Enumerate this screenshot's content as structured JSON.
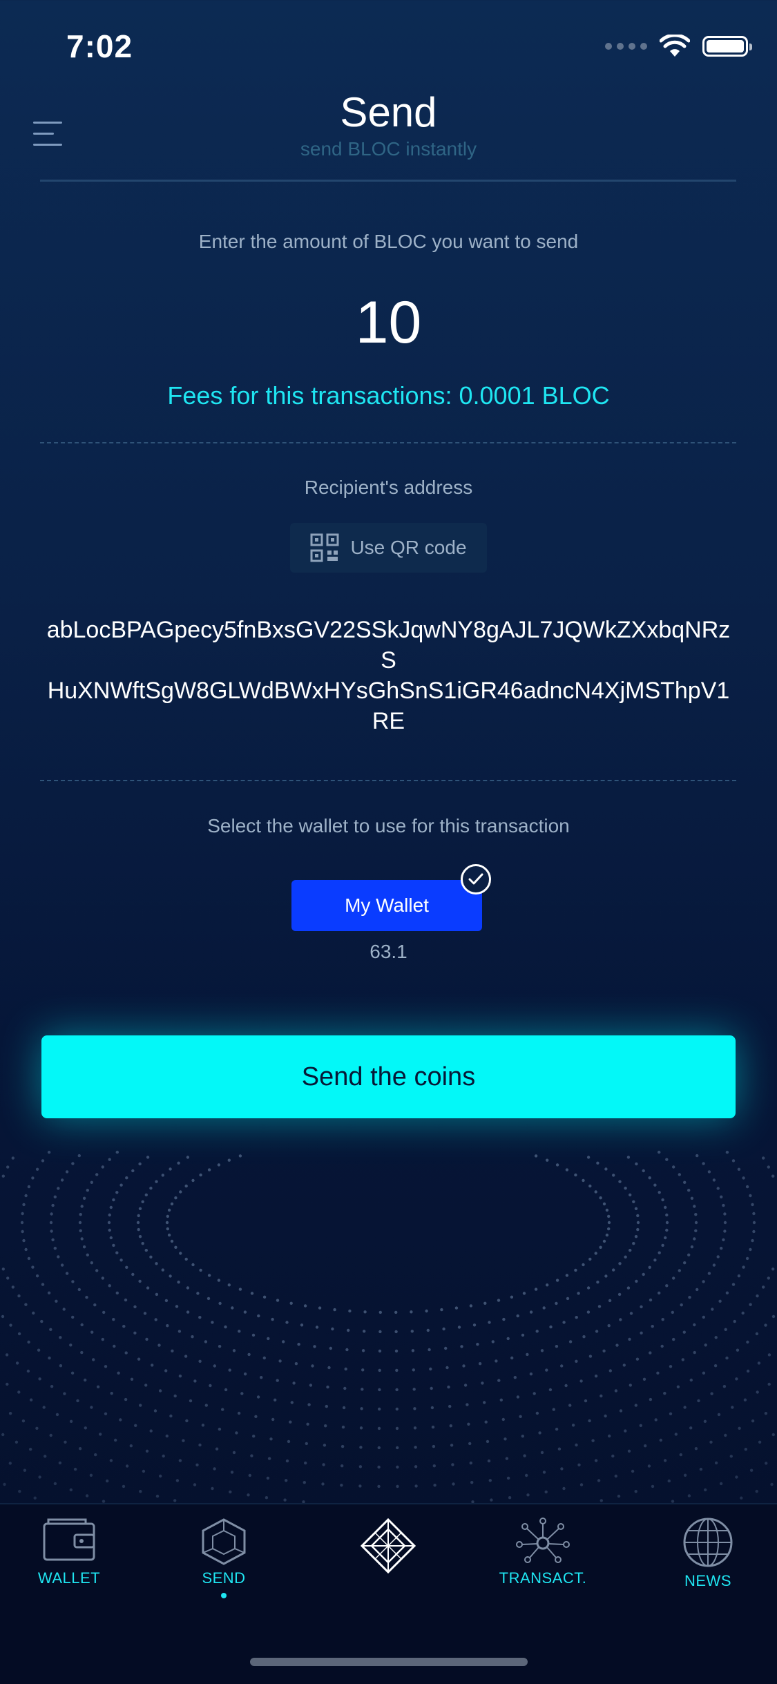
{
  "status_bar": {
    "time": "7:02"
  },
  "header": {
    "title": "Send",
    "subtitle": "send BLOC instantly",
    "menu_icon": "hamburger-menu-icon"
  },
  "amount": {
    "label": "Enter the amount of BLOC you want to send",
    "value": "10",
    "fees": "Fees for this transactions: 0.0001 BLOC"
  },
  "recipient": {
    "label": "Recipient's address",
    "qr_button_label": "Use QR code",
    "qr_icon": "qr-code-icon",
    "address_line1": "abLocBPAGpecy5fnBxsGV22SSkJqwNY8gAJL7JQWkZXxbqNRzS",
    "address_line2": "HuXNWftSgW8GLWdBWxHYsGhSnS1iGR46adncN4XjMSThpV1RE"
  },
  "wallet": {
    "label": "Select the wallet to use for this transaction",
    "name": "My Wallet",
    "balance": "63.1",
    "selected": true
  },
  "send_button": {
    "label": "Send the coins"
  },
  "bottom_nav": {
    "items": [
      {
        "label": "WALLET",
        "icon": "wallet-icon",
        "active": false
      },
      {
        "label": "SEND",
        "icon": "send-cube-icon",
        "active": true
      },
      {
        "label": "",
        "icon": "bloc-logo-icon",
        "active": false
      },
      {
        "label": "TRANSACT.",
        "icon": "network-nodes-icon",
        "active": false
      },
      {
        "label": "NEWS",
        "icon": "globe-icon",
        "active": false
      }
    ]
  },
  "colors": {
    "accent_cyan": "#03f8f8",
    "primary_blue": "#0a3cff",
    "background_top": "#0c2a53",
    "background_bottom": "#050f2a"
  }
}
